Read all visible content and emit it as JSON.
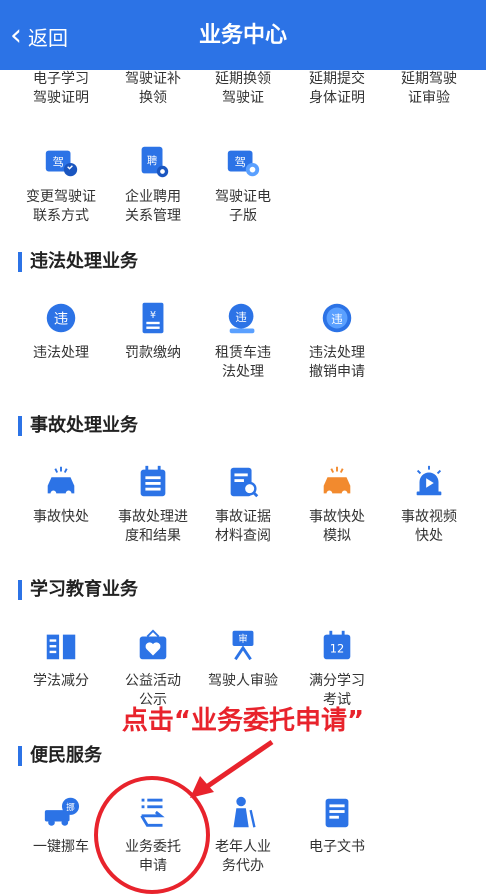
{
  "header": {
    "back_label": "返回",
    "title": "业务中心"
  },
  "top_row": [
    "电子学习\n驾驶证明",
    "驾驶证补\n换领",
    "延期换领\n驾驶证",
    "延期提交\n身体证明",
    "延期驾驶\n证审验"
  ],
  "license_row": [
    {
      "label": "变更驾驶证\n联系方式",
      "icon": "license-phone-icon"
    },
    {
      "label": "企业聘用\n关系管理",
      "icon": "hire-doc-icon"
    },
    {
      "label": "驾驶证电\n子版",
      "icon": "e-license-icon"
    }
  ],
  "sections": {
    "violation": {
      "title": "违法处理业务",
      "items": [
        "违法处理",
        "罚款缴纳",
        "租赁车违\n法处理",
        "违法处理\n撤销申请"
      ]
    },
    "accident": {
      "title": "事故处理业务",
      "items": [
        "事故快处",
        "事故处理进\n度和结果",
        "事故证据\n材料查阅",
        "事故快处\n模拟",
        "事故视频\n快处"
      ]
    },
    "education": {
      "title": "学习教育业务",
      "items": [
        "学法减分",
        "公益活动\n公示",
        "驾驶人审验",
        "满分学习\n考试"
      ]
    },
    "convenience": {
      "title": "便民服务",
      "items": [
        "一键挪车",
        "业务委托\n申请",
        "老年人业\n务代办",
        "电子文书"
      ]
    }
  },
  "icon_glyphs": {
    "violation": "违",
    "fine": "¥",
    "move": "挪",
    "review": "审",
    "score": "12",
    "license": "驾",
    "hire": "聘"
  },
  "annotation": "点击“业务委托申请”",
  "colors": {
    "primary": "#2c73e6",
    "accent": "#f28a2e",
    "highlight": "#e8232c"
  }
}
